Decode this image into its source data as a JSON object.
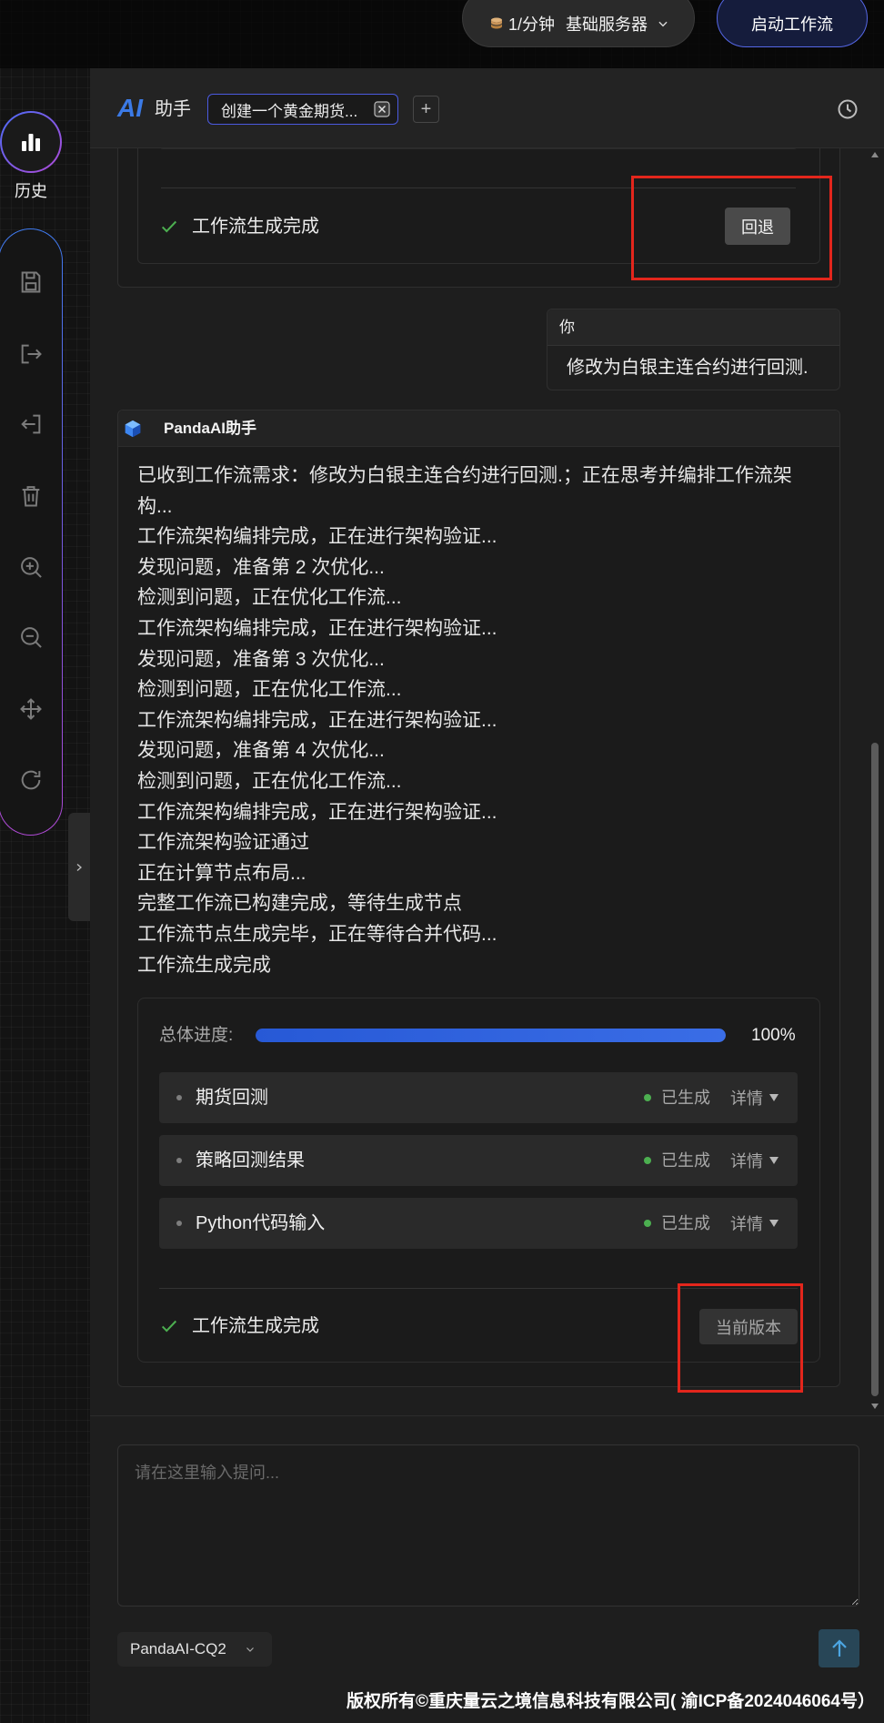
{
  "topbar": {
    "rate": "1/分钟",
    "server": "基础服务器",
    "start_button": "启动工作流"
  },
  "sidebar": {
    "history_label": "历史",
    "tools": [
      "save-icon",
      "logout-icon",
      "login-icon",
      "trash-icon",
      "zoom-in-icon",
      "zoom-out-icon",
      "move-icon",
      "refresh-icon"
    ]
  },
  "header": {
    "logo": "AI",
    "title": "助手",
    "tab_label": "创建一个黄金期货...",
    "add_tab": "+"
  },
  "previous_message": {
    "status": "工作流生成完成",
    "rollback_button": "回退"
  },
  "user_message": {
    "sender": "你",
    "text": "修改为白银主连合约进行回测."
  },
  "assistant_message": {
    "sender": "PandaAI助手",
    "lines": [
      "已收到工作流需求：修改为白银主连合约进行回测.；正在思考并编排工作流架构...",
      "工作流架构编排完成，正在进行架构验证...",
      "发现问题，准备第 2 次优化...",
      "检测到问题，正在优化工作流...",
      "工作流架构编排完成，正在进行架构验证...",
      "发现问题，准备第 3 次优化...",
      "检测到问题，正在优化工作流...",
      "工作流架构编排完成，正在进行架构验证...",
      "发现问题，准备第 4 次优化...",
      "检测到问题，正在优化工作流...",
      "工作流架构编排完成，正在进行架构验证...",
      "工作流架构验证通过",
      "正在计算节点布局...",
      "完整工作流已构建完成，等待生成节点",
      "工作流节点生成完毕，正在等待合并代码...",
      "工作流生成完成"
    ],
    "progress": {
      "label": "总体进度:",
      "value": 100,
      "percent_text": "100%"
    },
    "nodes": [
      {
        "name": "期货回测",
        "status": "已生成",
        "details": "详情"
      },
      {
        "name": "策略回测结果",
        "status": "已生成",
        "details": "详情"
      },
      {
        "name": "Python代码输入",
        "status": "已生成",
        "details": "详情"
      }
    ],
    "status": "工作流生成完成",
    "version_button": "当前版本"
  },
  "input": {
    "placeholder": "请在这里输入提问..."
  },
  "model_select": {
    "value": "PandaAI-CQ2"
  },
  "footer": {
    "copyright": "版权所有©重庆量云之境信息科技有限公司( 渝ICP备2024046064号）"
  },
  "colors": {
    "accent_blue": "#2f63d8",
    "success_green": "#4caf50",
    "highlight_red": "#e3261c",
    "tab_border": "#4b5ae0"
  }
}
